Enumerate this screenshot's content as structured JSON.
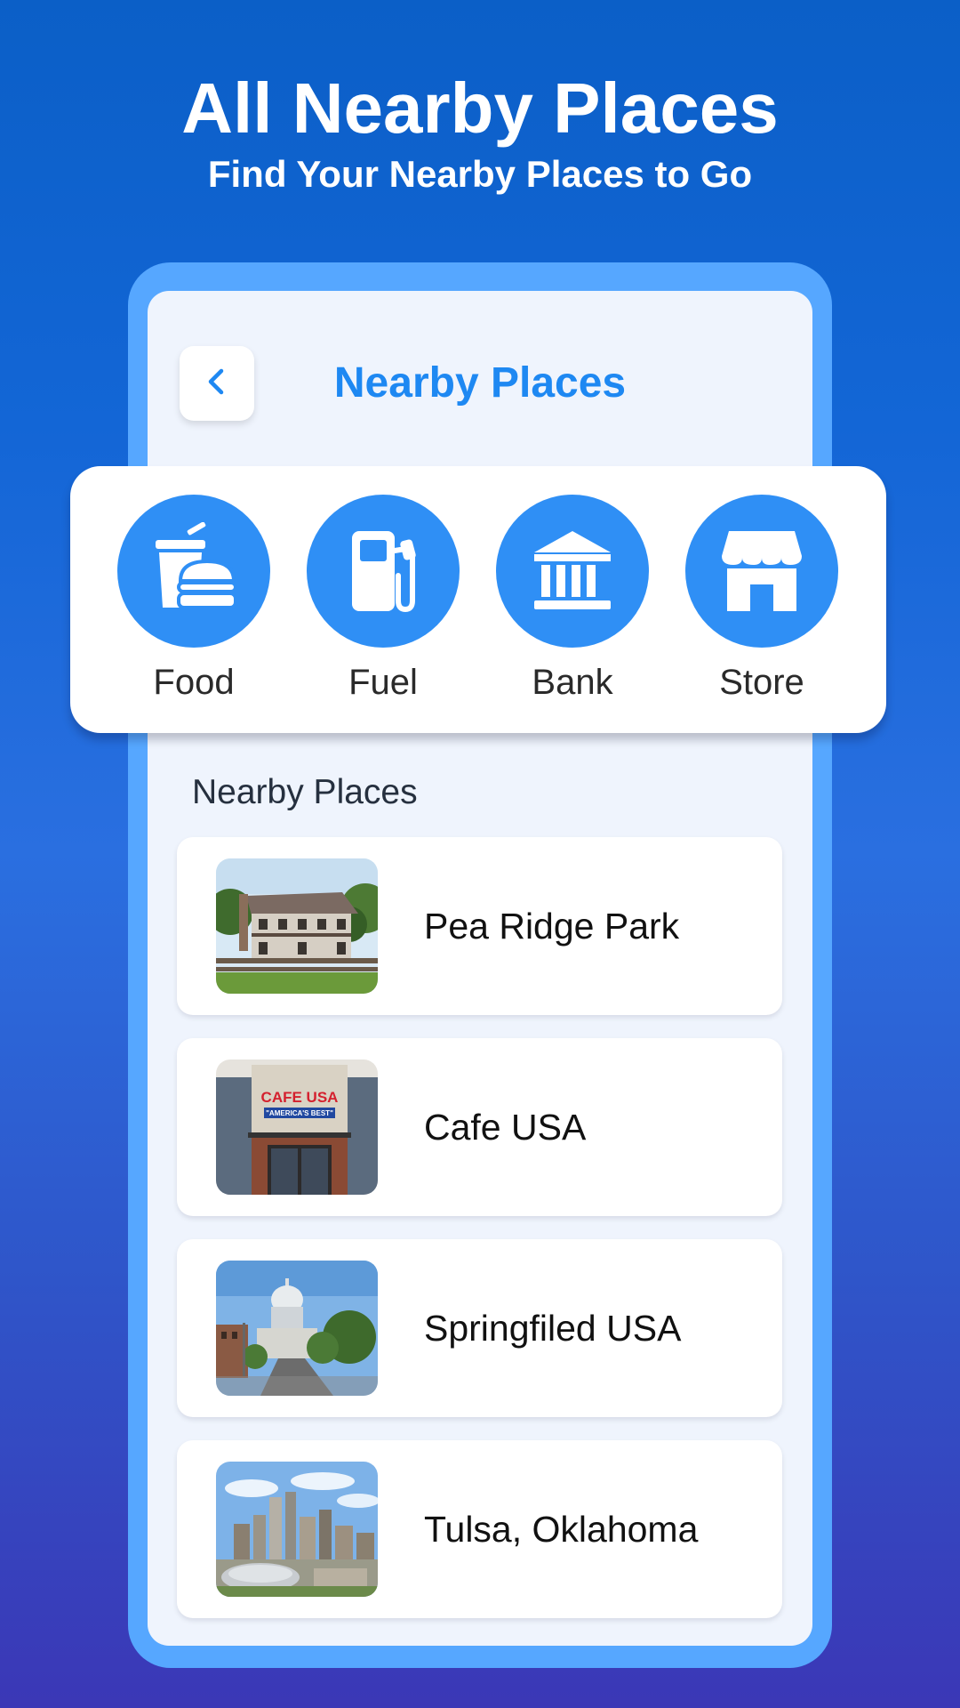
{
  "promo": {
    "title": "All Nearby Places",
    "subtitle": "Find Your Nearby Places to Go"
  },
  "app_bar": {
    "back_icon": "chevron-left-icon",
    "title": "Nearby Places"
  },
  "categories": [
    {
      "label": "Food",
      "icon": "food-icon"
    },
    {
      "label": "Fuel",
      "icon": "fuel-icon"
    },
    {
      "label": "Bank",
      "icon": "bank-icon"
    },
    {
      "label": "Store",
      "icon": "store-icon"
    }
  ],
  "list": {
    "title": "Nearby Places",
    "items": [
      {
        "name": "Pea Ridge Park"
      },
      {
        "name": "Cafe USA",
        "sign_text": "CAFE USA",
        "sign_subtext": "\"AMERICA'S BEST\""
      },
      {
        "name": "Springfiled USA"
      },
      {
        "name": "Tulsa, Oklahoma"
      }
    ]
  },
  "colors": {
    "accent": "#1e88f2",
    "category_circle": "#2f8ff5",
    "phone_frame": "#56a7ff",
    "screen_bg": "#eff4fd"
  }
}
